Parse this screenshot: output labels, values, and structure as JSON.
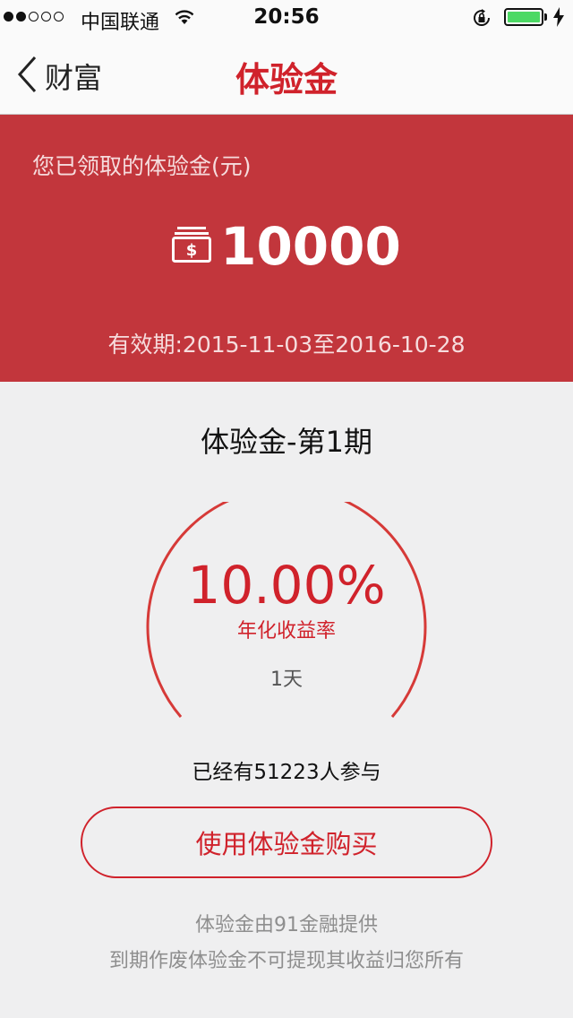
{
  "status_bar": {
    "carrier": "中国联通",
    "time": "20:56",
    "signal_bars_filled": 2,
    "signal_bars_total": 5,
    "battery_level": 1.0,
    "icons": [
      "wifi-icon",
      "rotation-lock-icon",
      "battery-icon",
      "charging-icon"
    ]
  },
  "nav": {
    "back_label": "财富",
    "title": "体验金"
  },
  "hero": {
    "label": "您已领取的体验金(元)",
    "amount": "10000",
    "amount_icon": "money-stack-icon",
    "validity_prefix": "有效期:",
    "validity_range": "2015-11-03至2016-10-28"
  },
  "product": {
    "name": "体验金-第1期",
    "rate": "10.00%",
    "rate_label": "年化收益率",
    "term": "1天",
    "participants": "已经有51223人参与"
  },
  "actions": {
    "buy_label": "使用体验金购买"
  },
  "footnotes": {
    "provider": "体验金由91金融提供",
    "notice": "到期作废体验金不可提现其收益归您所有"
  },
  "colors": {
    "accent": "#d0222b",
    "hero_bg": "#c2363c",
    "page_bg": "#efeff0",
    "battery": "#4cd964"
  }
}
